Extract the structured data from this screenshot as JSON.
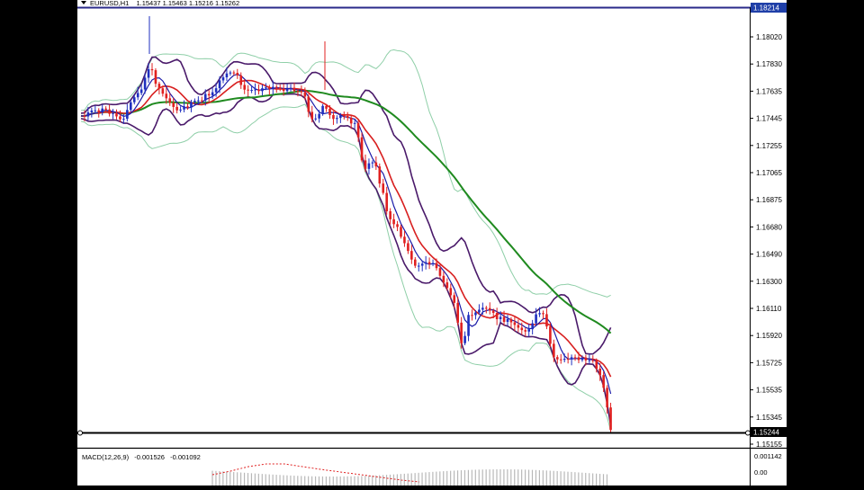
{
  "window": {
    "symbol_title": "EURUSD,H1",
    "ohlc": "1.15437 1.15463 1.15216 1.15262"
  },
  "price_axis": {
    "ticks": [
      "1.18020",
      "1.17830",
      "1.17635",
      "1.17445",
      "1.17255",
      "1.17065",
      "1.16875",
      "1.16680",
      "1.16490",
      "1.16300",
      "1.16110",
      "1.15920",
      "1.15725",
      "1.15535",
      "1.15345",
      "1.15155"
    ],
    "top_line_label": "1.18214",
    "current_price_label": "1.15244"
  },
  "macd": {
    "title": "MACD(12,26,9)",
    "value1": "-0.001526",
    "value2": "-0.001092",
    "ticks": [
      "0.001142",
      "0.00"
    ]
  },
  "colors": {
    "background": "#ffffff",
    "bull_candle": "#1f2fbf",
    "bear_candle": "#e02020",
    "ma_fast": "#1a1aa8",
    "ma_mid": "#d81f1f",
    "ma_slow": "#1f8a1f",
    "bands_inner": "#4a1a6a",
    "bands_outer": "#8fcfa8"
  }
}
